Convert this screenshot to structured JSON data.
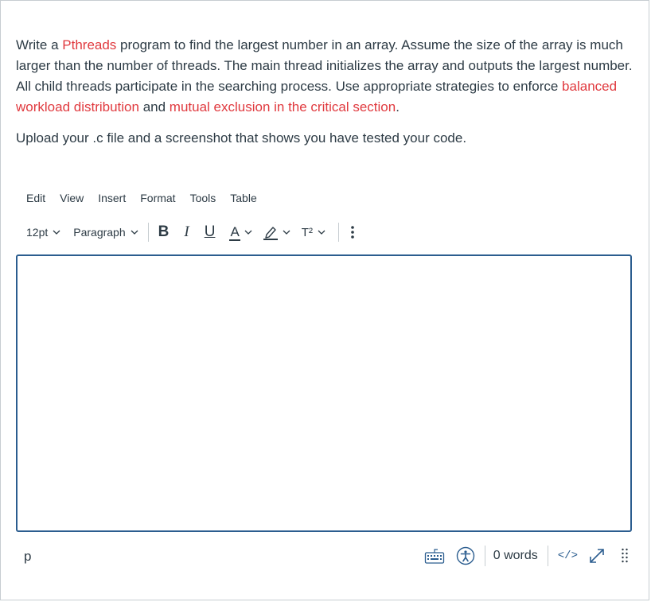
{
  "question": {
    "p1": {
      "t1": "Write a ",
      "h1": "Pthreads",
      "t2": " program to find the largest number in an array. Assume the size of the array is much larger than the number of threads. The main thread initializes the array and outputs the largest number. All child threads participate in the searching process. Use appropriate strategies to enforce ",
      "h2": "balanced workload distribution",
      "t3": " and ",
      "h3": "mutual exclusion in the critical section",
      "t4": "."
    },
    "p2": "Upload your .c file and a screenshot that shows you have tested your code."
  },
  "menubar": [
    "Edit",
    "View",
    "Insert",
    "Format",
    "Tools",
    "Table"
  ],
  "toolbar": {
    "font_size": "12pt",
    "block_format": "Paragraph",
    "bold": "B",
    "italic": "I",
    "underline": "U",
    "text_color": "A",
    "superscript": "T²"
  },
  "status": {
    "path": "p",
    "word_count": "0 words",
    "html_editor": "</>"
  },
  "colors": {
    "highlight": "#e0393e",
    "text": "#2d3b45",
    "editor_border": "#2b5d8f",
    "text_color_bar": "#2d3b45"
  }
}
